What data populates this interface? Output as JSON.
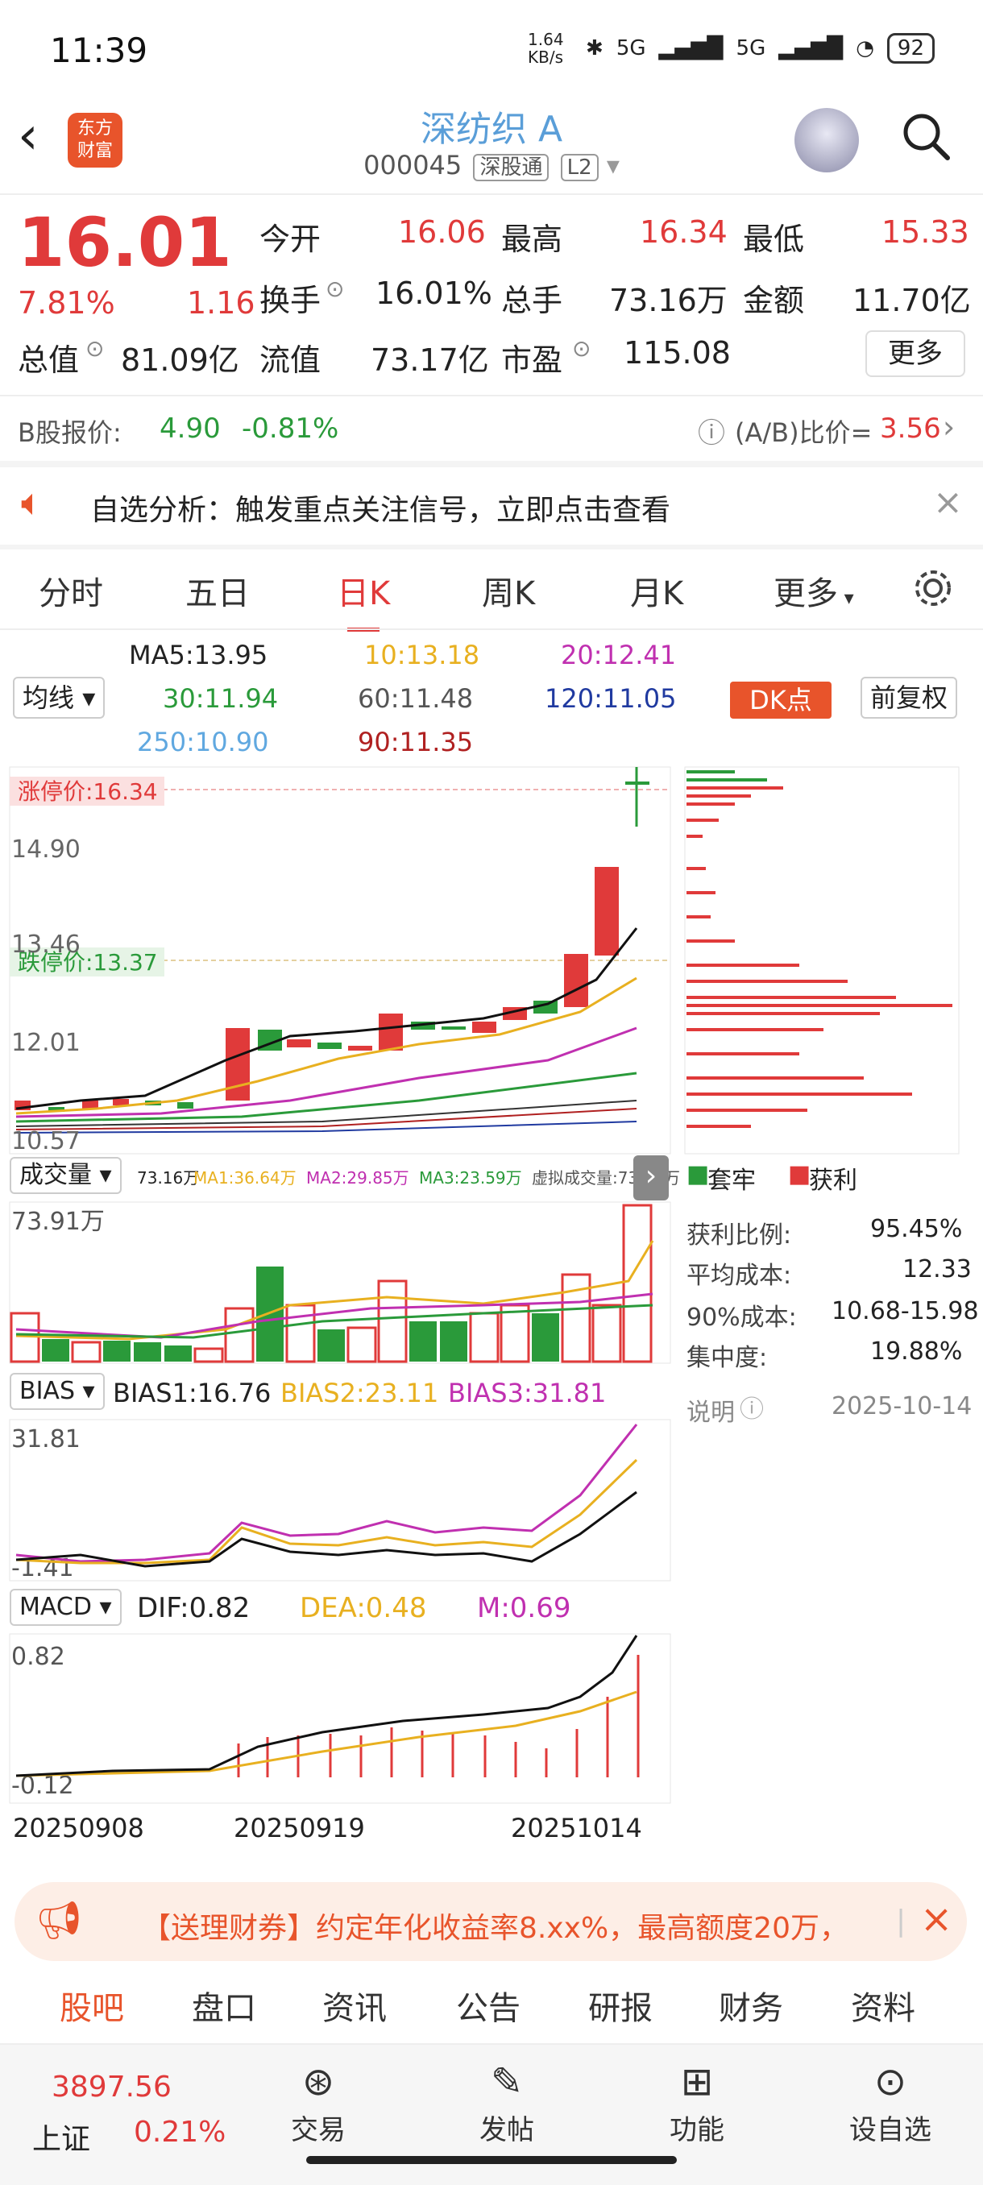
{
  "status": {
    "time": "11:39",
    "net_speed": "1.64 KB/s",
    "signal1": "5G",
    "signal2": "5G",
    "battery": "92"
  },
  "header": {
    "logo": "东方财富",
    "title": "深纺织 A",
    "code": "000045",
    "tag1": "深股通",
    "tag2": "L2"
  },
  "quote": {
    "price": "16.01",
    "pct": "7.81%",
    "change": "1.16",
    "open_label": "今开",
    "open": "16.06",
    "high_label": "最高",
    "high": "16.34",
    "low_label": "最低",
    "low": "15.33",
    "turnover_label": "换手",
    "turnover": "16.01%",
    "vol_label": "总手",
    "vol": "73.16万",
    "amount_label": "金额",
    "amount": "11.70亿",
    "mcap_label": "总值",
    "mcap": "81.09亿",
    "float_label": "流值",
    "float": "73.17亿",
    "pe_label": "市盈",
    "pe": "115.08",
    "more": "更多"
  },
  "bshare": {
    "label": "B股报价:",
    "price": "4.90",
    "pct": "-0.81%",
    "ratio_label": "(A/B)比价=",
    "ratio": "3.56"
  },
  "alert": {
    "text": "自选分析：触发重点关注信号，立即点击查看"
  },
  "tabs": [
    "分时",
    "五日",
    "日K",
    "周K",
    "月K",
    "更多"
  ],
  "ma": {
    "ma5": "MA5:13.95",
    "ma10": "10:13.18",
    "ma20": "20:12.41",
    "ma30": "30:11.94",
    "ma60": "60:11.48",
    "ma120": "120:11.05",
    "ma250": "250:10.90",
    "ma90": "90:11.35",
    "selector": "均线",
    "dk": "DK点",
    "fq": "前复权"
  },
  "kline": {
    "upper_limit": "涨停价:16.34",
    "lower_limit": "跌停价:13.37",
    "y1": "16.34",
    "y2": "14.90",
    "y3": "13.46",
    "y4": "12.01",
    "y5": "10.57"
  },
  "volume": {
    "selector": "成交量",
    "info": "73.16万",
    "ma1": "MA1:36.64万",
    "ma2": "MA2:29.85万",
    "ma3": "MA3:23.59万",
    "virtual": "虚拟成交量:73.91万",
    "ymax": "73.91万"
  },
  "bias": {
    "selector": "BIAS",
    "b1": "BIAS1:16.76",
    "b2": "BIAS2:23.11",
    "b3": "BIAS3:31.81",
    "ymax": "31.81",
    "ymin": "-1.41"
  },
  "macd": {
    "selector": "MACD",
    "dif": "DIF:0.82",
    "dea": "DEA:0.48",
    "m": "M:0.69",
    "ymax": "0.82",
    "ymin": "-0.12"
  },
  "dates": [
    "20250908",
    "20250919",
    "20251014"
  ],
  "chips": {
    "legend1": "套牢",
    "legend2": "获利",
    "rows": [
      [
        "获利比例:",
        "95.45%"
      ],
      [
        "平均成本:",
        "12.33"
      ],
      [
        "90%成本:",
        "10.68-15.98"
      ],
      [
        "集中度:",
        "19.88%"
      ]
    ],
    "note": "说明",
    "date": "2025-10-14"
  },
  "banner": {
    "text": "【送理财券】约定年化收益率8.xx%，最高额度20万，"
  },
  "btabs": [
    "股吧",
    "盘口",
    "资讯",
    "公告",
    "研报",
    "财务",
    "资料"
  ],
  "bottom": {
    "index_val": "3897.56",
    "index_name": "上证",
    "index_pct": "0.21%",
    "items": [
      "交易",
      "发帖",
      "功能",
      "设自选"
    ]
  },
  "colors": {
    "up": "#e03a3a",
    "down": "#2a9a3a",
    "accent": "#e8542b"
  }
}
